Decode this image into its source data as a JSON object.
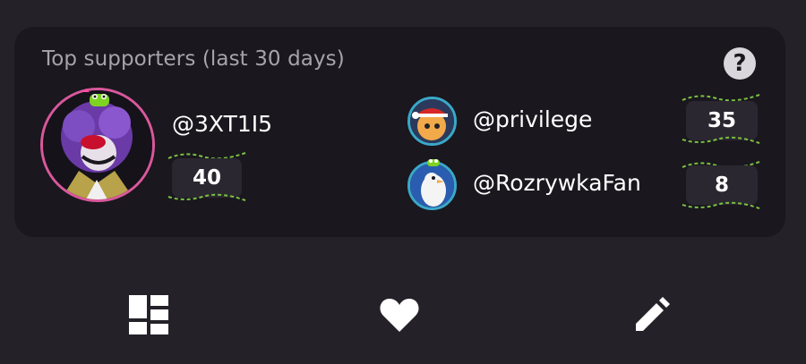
{
  "card": {
    "title": "Top supporters (last 30 days)"
  },
  "supporters": [
    {
      "username": "@3XT1I5",
      "count": "40"
    },
    {
      "username": "@privilege",
      "count": "35"
    },
    {
      "username": "@RozrywkaFan",
      "count": "8"
    }
  ],
  "icons": {
    "help": "?",
    "dashboard": "dashboard-icon",
    "heart": "heart-icon",
    "edit": "pencil-icon"
  },
  "colors": {
    "background": "#242129",
    "card": "#1a171e",
    "title": "#a6a3ab",
    "top_avatar_ring": "#d9589c",
    "avatar_ring": "#3aa9c9",
    "vine": "#7ac142"
  }
}
